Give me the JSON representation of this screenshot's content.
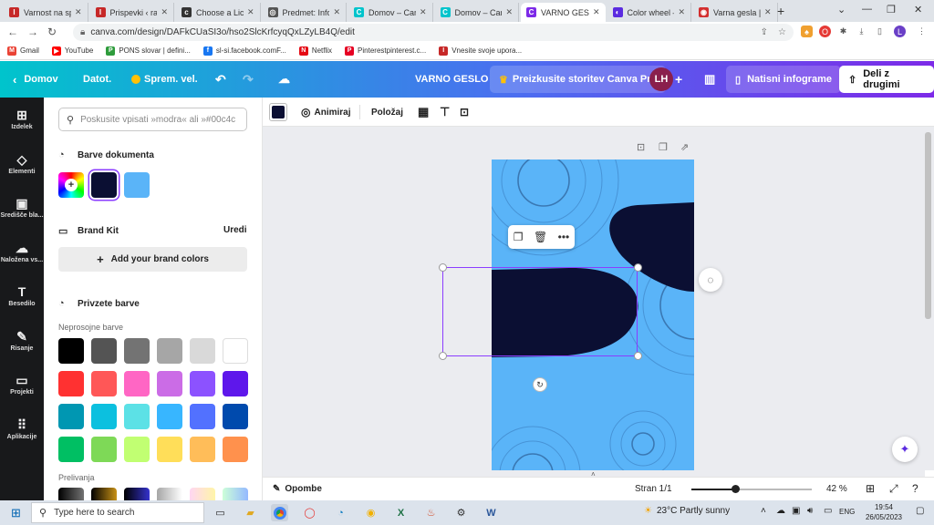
{
  "browser": {
    "tabs": [
      {
        "title": "Varnost na sp",
        "fav_color": "#c62828",
        "fav_glyph": "I"
      },
      {
        "title": "Prispevki ‹ razı",
        "fav_color": "#c62828",
        "fav_glyph": "I"
      },
      {
        "title": "Choose a Lice",
        "fav_color": "#333333",
        "fav_glyph": "c"
      },
      {
        "title": "Predmet: Infor",
        "fav_color": "#555555",
        "fav_glyph": "◎"
      },
      {
        "title": "Domov – Canv",
        "fav_color": "#00c4cc",
        "fav_glyph": "C"
      },
      {
        "title": "Domov – Canv",
        "fav_color": "#00c4cc",
        "fav_glyph": "C"
      },
      {
        "title": "VARNO GESLO",
        "fav_color": "#7d2ae8",
        "fav_glyph": "C"
      },
      {
        "title": "Color wheel –",
        "fav_color": "#5b2be0",
        "fav_glyph": "◐"
      },
      {
        "title": "Varna gesla | S",
        "fav_color": "#d32f2f",
        "fav_glyph": "◉"
      }
    ],
    "url": "canva.com/design/DAFkCUaSI3o/hso2SlcKrfcyqQxLZyLB4Q/edit",
    "bookmarks": [
      {
        "label": "Gmail",
        "color": "#ea4335",
        "glyph": "M"
      },
      {
        "label": "YouTube",
        "color": "#ff0000",
        "glyph": "▶"
      },
      {
        "label": "PONS slovar | defini...",
        "color": "#2e9c3c",
        "glyph": "P"
      },
      {
        "label": "sl-si.facebook.comF...",
        "color": "#1877f2",
        "glyph": "f"
      },
      {
        "label": "Netflix",
        "color": "#e50914",
        "glyph": "N"
      },
      {
        "label": "Pinterestpinterest.c...",
        "color": "#e60023",
        "glyph": "P"
      },
      {
        "label": "Vnesite svoje upora...",
        "color": "#c62828",
        "glyph": "I"
      }
    ],
    "profile_initial": "L"
  },
  "topbar": {
    "home": "Domov",
    "file": "Datot.",
    "resize": "Sprem. vel.",
    "title": "VARNO GESLO",
    "pro": "Preizkusite storitev Canva Pro",
    "avatar": "LH",
    "print": "Natisni infograme",
    "share": "Deli z drugimi"
  },
  "rail": [
    {
      "label": "Izdelek",
      "icon": "⊞"
    },
    {
      "label": "Elementi",
      "icon": "◇"
    },
    {
      "label": "Središče bla...",
      "icon": "▣"
    },
    {
      "label": "Naložena vs...",
      "icon": "☁"
    },
    {
      "label": "Besedilo",
      "icon": "T"
    },
    {
      "label": "Risanje",
      "icon": "✎"
    },
    {
      "label": "Projekti",
      "icon": "▭"
    },
    {
      "label": "Aplikacije",
      "icon": "⠿"
    }
  ],
  "panel": {
    "search_placeholder": "Poskusite vpisati »modra« ali »#00c4c",
    "doc_colors_title": "Barve dokumenta",
    "brand_kit_title": "Brand Kit",
    "edit": "Uredi",
    "add_brand": "Add your brand colors",
    "default_colors_title": "Privzete barve",
    "solid_label": "Neprosojne barve",
    "gradient_label": "Prelivanja",
    "doc_colors": [
      "#0b0f33",
      "#5ab4f8"
    ],
    "solid_colors": [
      "#000000",
      "#545454",
      "#737373",
      "#a6a6a6",
      "#d9d9d9",
      "#ffffff",
      "#ff3131",
      "#ff5757",
      "#ff66c4",
      "#cb6ce6",
      "#8c52ff",
      "#5e17eb",
      "#0097b2",
      "#0cc0df",
      "#5ce1e6",
      "#38b6ff",
      "#5271ff",
      "#004aad",
      "#00bf63",
      "#7ed957",
      "#c1ff72",
      "#ffde59",
      "#ffbd59",
      "#ff914d"
    ],
    "gradient_colors": [
      "linear-gradient(90deg,#000,#737373)",
      "linear-gradient(90deg,#000,#c89116)",
      "linear-gradient(90deg,#000,#3533cd)",
      "linear-gradient(90deg,#a6a6a6,#fff)",
      "linear-gradient(90deg,#ffd6f2,#fff5a8)",
      "linear-gradient(90deg,#cdffd8,#94b9ff)"
    ]
  },
  "ctx": {
    "animate": "Animiraj",
    "position": "Položaj",
    "selected_color": "#0b0f33"
  },
  "bottombar": {
    "notes": "Opombe",
    "page": "Stran 1/1",
    "zoom": "42 %"
  },
  "taskbar": {
    "search": "Type here to search",
    "weather": "23°C  Partly sunny",
    "lang": "ENG",
    "time": "19:54",
    "date": "26/05/2023"
  },
  "colors": {
    "canvas_blue": "#5ab4f8",
    "shape_navy": "#0b0f33",
    "selection": "#8b3dff"
  }
}
